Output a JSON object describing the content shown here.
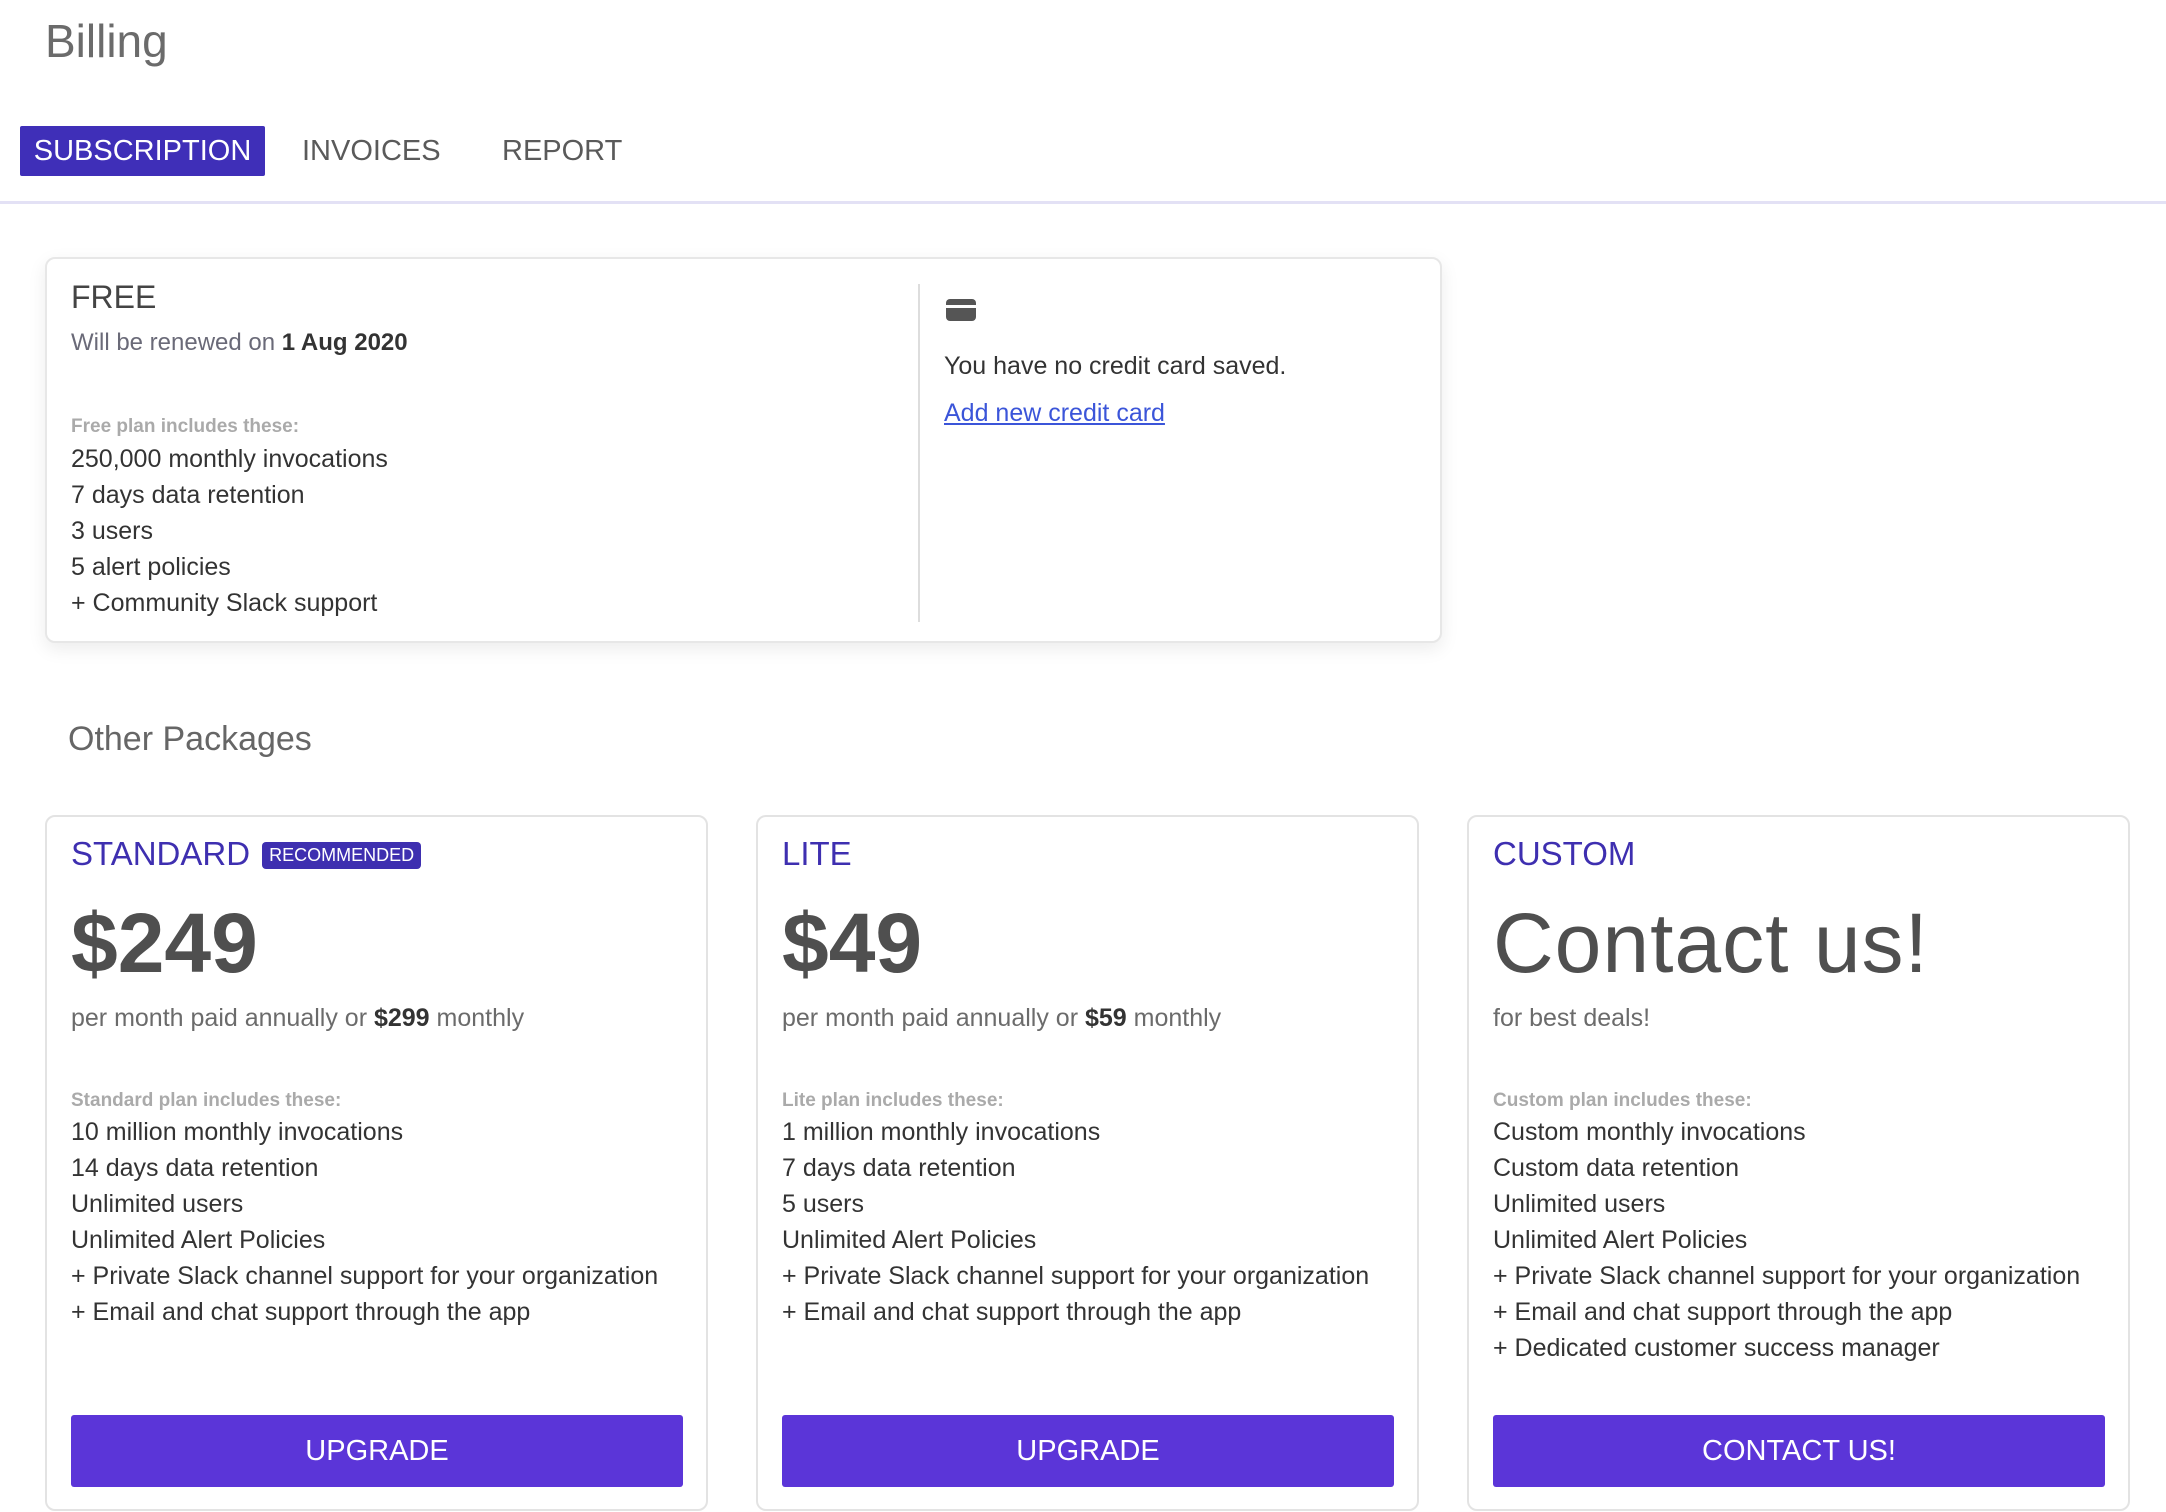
{
  "page": {
    "title": "Billing"
  },
  "tabs": [
    {
      "label": "SUBSCRIPTION",
      "active": true
    },
    {
      "label": "INVOICES",
      "active": false
    },
    {
      "label": "REPORT",
      "active": false
    }
  ],
  "current_plan": {
    "name": "FREE",
    "renew_prefix": "Will be renewed on ",
    "renew_date": "1 Aug 2020",
    "includes_caption": "Free plan includes these:",
    "features": [
      "250,000 monthly invocations",
      "7 days data retention",
      "3 users",
      "5 alert policies",
      "+ Community Slack support"
    ],
    "payment": {
      "icon": "credit-card-icon",
      "message": "You have no credit card saved.",
      "add_card_label": "Add new credit card"
    }
  },
  "other_packages": {
    "title": "Other Packages",
    "items": [
      {
        "name": "STANDARD",
        "badge": "RECOMMENDED",
        "price": "$249",
        "billing_prefix": "per month paid annually or ",
        "billing_monthly": "$299",
        "billing_suffix": " monthly",
        "includes_caption": "Standard plan includes these:",
        "features": [
          "10 million monthly invocations",
          "14 days data retention",
          "Unlimited users",
          "Unlimited Alert Policies",
          "+ Private Slack channel support for your organization",
          "+ Email and chat support through the app"
        ],
        "button_label": "UPGRADE"
      },
      {
        "name": "LITE",
        "price": "$49",
        "billing_prefix": "per month paid annually or ",
        "billing_monthly": "$59",
        "billing_suffix": " monthly",
        "includes_caption": "Lite plan includes these:",
        "features": [
          "1 million monthly invocations",
          "7 days data retention",
          "5 users",
          "Unlimited Alert Policies",
          "+ Private Slack channel support for your organization",
          "+ Email and chat support through the app"
        ],
        "button_label": "UPGRADE"
      },
      {
        "name": "CUSTOM",
        "price": "Contact us!",
        "billing_text": "for best deals!",
        "includes_caption": "Custom plan includes these:",
        "features": [
          "Custom monthly invocations",
          "Custom data retention",
          "Unlimited users",
          "Unlimited Alert Policies",
          "+ Private Slack channel support for your organization",
          "+ Email and chat support through the app",
          "+ Dedicated customer success manager"
        ],
        "button_label": "CONTACT US!"
      }
    ]
  },
  "colors": {
    "accent": "#3f2fb8",
    "button": "#5b35d8",
    "link": "#3b55d9"
  }
}
